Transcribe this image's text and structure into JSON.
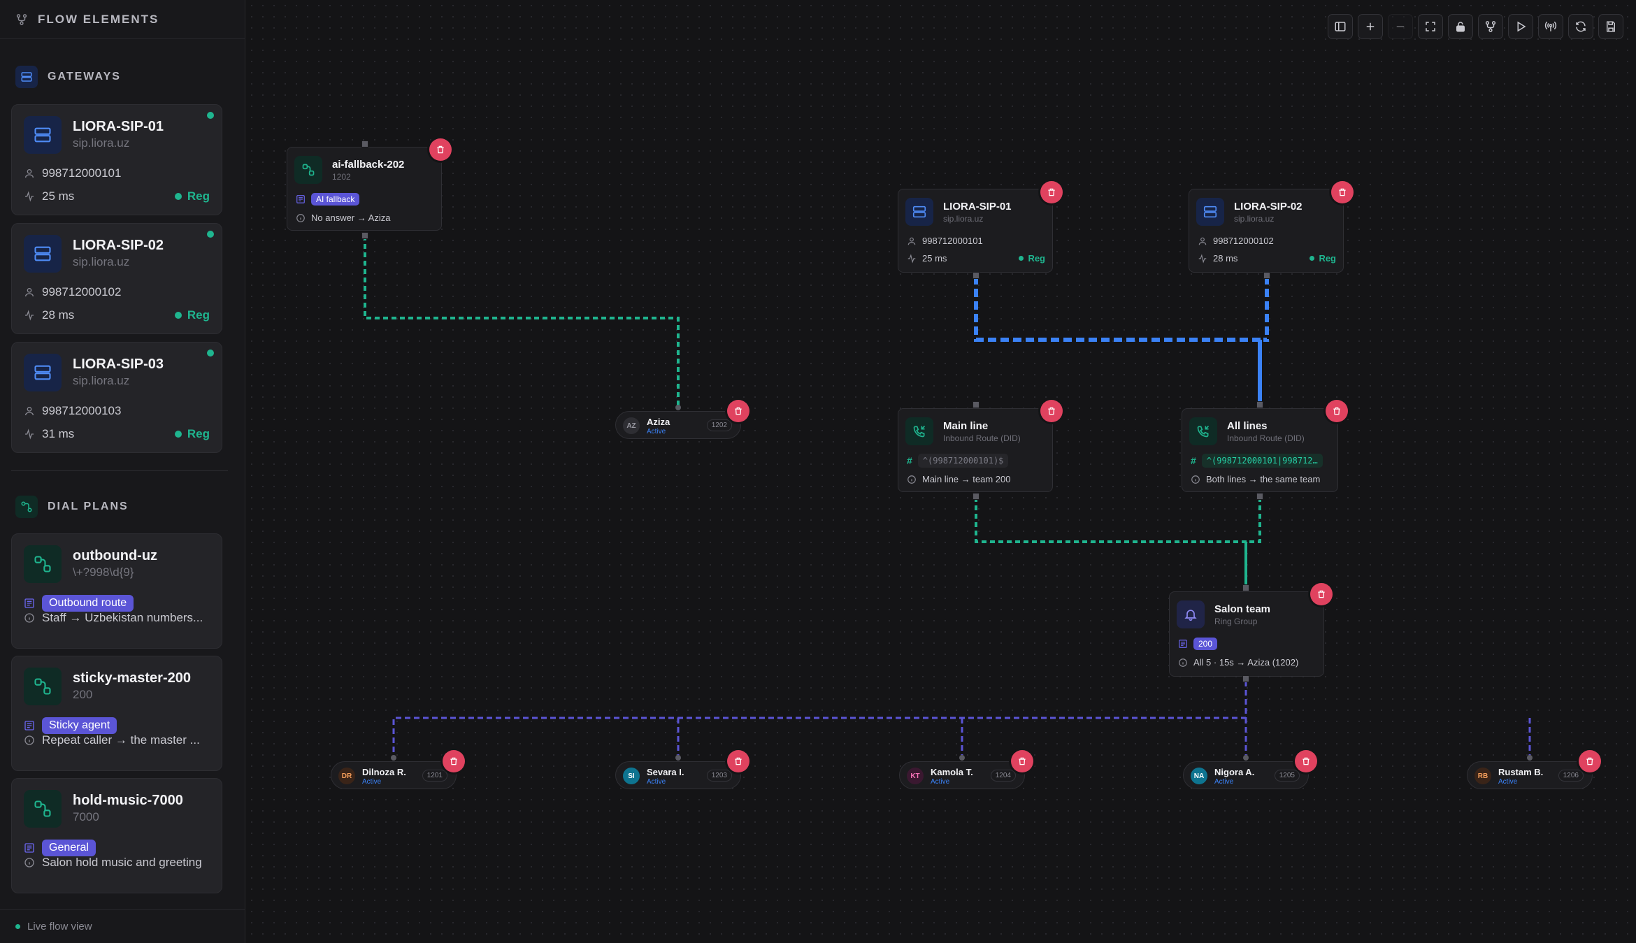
{
  "sidebar": {
    "title": "FLOW ELEMENTS",
    "gateways_title": "GATEWAYS",
    "gateways": [
      {
        "name": "LIORA-SIP-01",
        "host": "sip.liora.uz",
        "number": "998712000101",
        "latency": "25 ms",
        "status": "Reg"
      },
      {
        "name": "LIORA-SIP-02",
        "host": "sip.liora.uz",
        "number": "998712000102",
        "latency": "28 ms",
        "status": "Reg"
      },
      {
        "name": "LIORA-SIP-03",
        "host": "sip.liora.uz",
        "number": "998712000103",
        "latency": "31 ms",
        "status": "Reg"
      }
    ],
    "dialplans_title": "DIAL PLANS",
    "dialplans": [
      {
        "name": "outbound-uz",
        "pattern": "\\+?998\\d{9}",
        "tag": "Outbound route",
        "desc": "Staff → Uzbekistan numbers..."
      },
      {
        "name": "sticky-master-200",
        "pattern": "200",
        "tag": "Sticky agent",
        "desc": "Repeat caller → the master ..."
      },
      {
        "name": "hold-music-7000",
        "pattern": "7000",
        "tag": "General",
        "desc": "Salon hold music and greeting"
      }
    ],
    "footer": "Live flow view"
  },
  "canvas": {
    "fallback": {
      "name": "ai-fallback-202",
      "ext": "1202",
      "tag": "AI fallback",
      "desc": "No answer → Aziza"
    },
    "gw1": {
      "name": "LIORA-SIP-01",
      "host": "sip.liora.uz",
      "number": "998712000101",
      "latency": "25 ms",
      "status": "Reg"
    },
    "gw2": {
      "name": "LIORA-SIP-02",
      "host": "sip.liora.uz",
      "number": "998712000102",
      "latency": "28 ms",
      "status": "Reg"
    },
    "route_main": {
      "name": "Main line",
      "type": "Inbound Route (DID)",
      "pattern": "^(998712000101)$",
      "desc": "Main line → team 200"
    },
    "route_all": {
      "name": "All lines",
      "type": "Inbound Route (DID)",
      "pattern": "^(998712000101|998712…",
      "desc": "Both lines → the same team"
    },
    "ring_group": {
      "name": "Salon team",
      "type": "Ring Group",
      "ext": "200",
      "desc": "All 5 · 15s → Aziza (1202)"
    },
    "aziza": {
      "initials": "AZ",
      "name": "Aziza",
      "status": "Active",
      "ext": "1202"
    },
    "agents": [
      {
        "initials": "DR",
        "name": "Dilnoza R.",
        "status": "Active",
        "ext": "1201",
        "color": "#f59e5b",
        "bg": "#3a2418"
      },
      {
        "initials": "SI",
        "name": "Sevara I.",
        "status": "Active",
        "ext": "1203",
        "color": "#ffffff",
        "bg": "#0e7490"
      },
      {
        "initials": "KT",
        "name": "Kamola T.",
        "status": "Active",
        "ext": "1204",
        "color": "#f472b6",
        "bg": "#3a1830"
      },
      {
        "initials": "NA",
        "name": "Nigora A.",
        "status": "Active",
        "ext": "1205",
        "color": "#ffffff",
        "bg": "#0e7490"
      },
      {
        "initials": "RB",
        "name": "Rustam B.",
        "status": "Active",
        "ext": "1206",
        "color": "#f59e5b",
        "bg": "#3a2418"
      }
    ]
  },
  "toolbar": [
    "panel-icon",
    "zoom-in-icon",
    "zoom-out-icon",
    "fit-view-icon",
    "lock-icon",
    "layout-icon",
    "play-icon",
    "broadcast-icon",
    "refresh-icon",
    "save-icon"
  ],
  "colors": {
    "accent_teal": "#1fb58f",
    "accent_blue": "#3b82f6",
    "accent_purple": "#5b55d6",
    "danger": "#e0425f"
  }
}
